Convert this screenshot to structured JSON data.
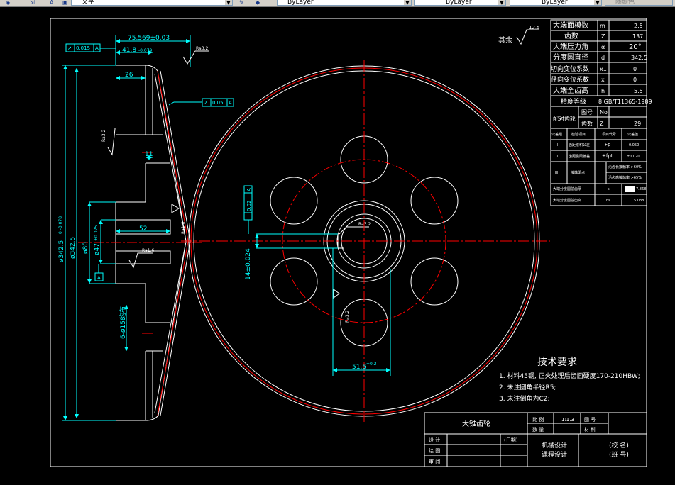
{
  "toolbar": {
    "text_style": "文字",
    "layer_color": "ByLayer",
    "layer_linetype": "ByLayer",
    "layer_lineweight": "ByLayer",
    "plot_style": "随颜色"
  },
  "drawing": {
    "dims": {
      "length_main": "75.569±0.03",
      "d418": "41.8",
      "d418_tol": "-0.079",
      "d26": "26",
      "d11": "11",
      "d52": "52",
      "d80": "ø80",
      "d47": "ø47",
      "d47_tol": "+0.025",
      "d342_outer": "ø342.5",
      "d342_outer_tol": "0 -0.078",
      "d342": "ø342.5",
      "d158": "6-ø158",
      "even": "均布",
      "d14": "14±0.024",
      "d515": "51.5",
      "d515_tol": "+0.2"
    },
    "tolerances": {
      "flat": "0.015",
      "flat_datum": "A",
      "runout": "0.05",
      "runout_datum": "A",
      "sym": "0.02",
      "sym_datum": "A",
      "datum_A": "A"
    },
    "roughness": {
      "r32a": "Ra3.2",
      "r32b": "Ra3.2",
      "r32c": "Ra3.2",
      "r16a": "Ra1.6",
      "r16b": "Ra1.6",
      "r32d": "Ra3.2",
      "r32e": "Ra3.2",
      "rest_label": "其余",
      "rest_value": "12.5"
    },
    "params": [
      {
        "label": "大端面模数",
        "sym": "m",
        "val": "2.5"
      },
      {
        "label": "齿数",
        "sym": "Z",
        "val": "137"
      },
      {
        "label": "大端压力角",
        "sym": "α",
        "val": "20°"
      },
      {
        "label": "分度圆直径",
        "sym": "d",
        "val": "342.5"
      },
      {
        "label": "切向变位系数",
        "sym": "x1",
        "val": "0"
      },
      {
        "label": "径向变位系数",
        "sym": "x",
        "val": "0"
      },
      {
        "label": "大端全齿高",
        "sym": "h",
        "val": "5.5"
      }
    ],
    "precision": {
      "label": "精度等级",
      "val": "8 GB/T11365-1989"
    },
    "pair": {
      "label": "配对齿轮",
      "row1_label": "图号",
      "row1_val": "No",
      "row2_label": "齿数",
      "row2_val": "Z",
      "row2_num": "29"
    },
    "inspect_header": {
      "c1": "公差组",
      "c2": "检验项目",
      "c3": "项目代号",
      "c4": "公差值"
    },
    "inspect": [
      {
        "g": "I",
        "item": "齿距累积公差",
        "code": "Fp",
        "val": "0.050"
      },
      {
        "g": "II",
        "item": "齿距极限偏差",
        "code": "±fpt",
        "val": "±0.020"
      },
      {
        "g": "III",
        "item": "接触斑点",
        "code": "沿齿长接触率 >60%",
        "code2": "沿齿高接触率 >65%"
      },
      {
        "g": "",
        "item": "大端分度圆弦齿厚",
        "code": "s",
        "val": "7.868"
      },
      {
        "g": "",
        "item": "大端分度圆弦齿高",
        "code": "hs",
        "val": "5.038"
      }
    ],
    "tech_req": {
      "title": "技术要求",
      "l1": "1. 材料45钢, 正火处理后齿面硬度170-210HBW;",
      "l2": "2. 未注圆角半径R5;",
      "l3": "3. 未注倒角为C2;"
    },
    "title_block": {
      "part": "大锥齿轮",
      "scale_label": "比 例",
      "scale": "1:1.3",
      "drawno_label": "图 号",
      "qty_label": "数 量",
      "mat_label": "材 料",
      "design": "设 计",
      "date": "(日期)",
      "draw": "绘 图",
      "review": "审 阅",
      "course1": "机械设计",
      "course2": "课程设计",
      "school": "(校 名)",
      "class": "(班 号)"
    }
  }
}
